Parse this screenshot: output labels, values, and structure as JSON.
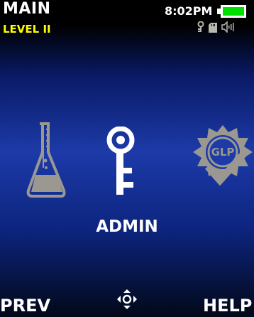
{
  "header": {
    "title": "MAIN",
    "level": "LEVEL II",
    "time": "8:02PM"
  },
  "status": {
    "battery_color": "#00e000",
    "icons": [
      "key-icon",
      "sd-card-icon",
      "speaker-icon"
    ]
  },
  "carousel": {
    "items": [
      "flask-icon",
      "key-icon",
      "glp-icon"
    ],
    "selected_label": "ADMIN"
  },
  "softkeys": {
    "left": "PREV",
    "right": "HELP"
  },
  "colors": {
    "level": "#ffff00",
    "dimmed_icon": "#9a9890"
  }
}
